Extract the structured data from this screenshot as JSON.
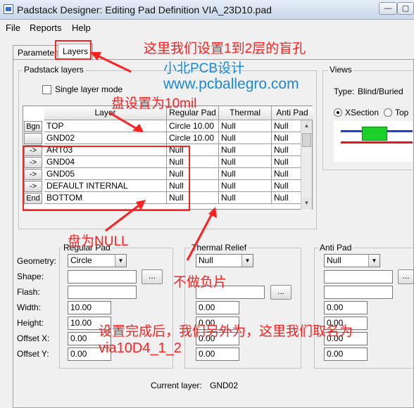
{
  "window": {
    "title": "Padstack Designer: Editing Pad Definition VIA_23D10.pad",
    "minimize": "—",
    "maximize": "▢"
  },
  "menu": [
    "File",
    "Reports",
    "Help"
  ],
  "tabs": [
    "Parameters",
    "Layers"
  ],
  "padstack_layers": {
    "group_label": "Padstack layers",
    "single_layer_mode": "Single layer mode",
    "columns": [
      "Layer",
      "Regular Pad",
      "Thermal Relief",
      "Anti Pad"
    ],
    "rows": [
      {
        "btn": "Bgn",
        "layer": "TOP",
        "regular": "Circle 10.00",
        "thermal": "Null",
        "anti": "Null"
      },
      {
        "btn": "",
        "layer": "GND02",
        "regular": "Circle 10.00",
        "thermal": "Null",
        "anti": "Null"
      },
      {
        "btn": "->",
        "layer": "ART03",
        "regular": "Null",
        "thermal": "Null",
        "anti": "Null"
      },
      {
        "btn": "->",
        "layer": "GND04",
        "regular": "Null",
        "thermal": "Null",
        "anti": "Null"
      },
      {
        "btn": "->",
        "layer": "GND05",
        "regular": "Null",
        "thermal": "Null",
        "anti": "Null"
      },
      {
        "btn": "->",
        "layer": "DEFAULT INTERNAL",
        "regular": "Null",
        "thermal": "Null",
        "anti": "Null"
      },
      {
        "btn": "End",
        "layer": "BOTTOM",
        "regular": "Null",
        "thermal": "Null",
        "anti": "Null"
      }
    ]
  },
  "views": {
    "group_label": "Views",
    "type_label": "Type:",
    "type_value": "Blind/Buried",
    "xsection": "XSection",
    "top": "Top",
    "colors": {
      "blue": "#1f3fd0",
      "red": "#e01818",
      "green": "#1dd12a"
    }
  },
  "pad_form": {
    "labels": [
      "Geometry:",
      "Shape:",
      "Flash:",
      "Width:",
      "Height:",
      "Offset X:",
      "Offset Y:"
    ],
    "regular": {
      "label": "Regular Pad",
      "geometry": "Circle",
      "width": "10.00",
      "height": "10.00",
      "offset_x": "0.00",
      "offset_y": "0.00"
    },
    "thermal": {
      "label": "Thermal Relief",
      "geometry": "Null",
      "width": "0.00",
      "height": "0.00",
      "offset_x": "0.00",
      "offset_y": "0.00"
    },
    "anti": {
      "label": "Anti Pad",
      "geometry": "Null",
      "width": "0.00",
      "height": "0.00",
      "offset_x": "0.00",
      "offset_y": "0.00"
    },
    "dots": "..."
  },
  "current_layer": {
    "label": "Current layer:",
    "value": "GND02"
  },
  "annotations": {
    "blind_via": "这里我们设置1到2层的盲孔",
    "brand": "小北PCB设计",
    "site": "www.pcballegro.com",
    "pad_10mil": "盘设置为10mil",
    "pad_null": "盘为NULL",
    "no_negative": "不做负片",
    "naming": "设置完成后，我们另外为，这里我们取名为",
    "name": "via10D4_1_2"
  },
  "accent": {
    "annotation_red": "#ff2020",
    "annotation_blue": "#1a8ad8"
  }
}
